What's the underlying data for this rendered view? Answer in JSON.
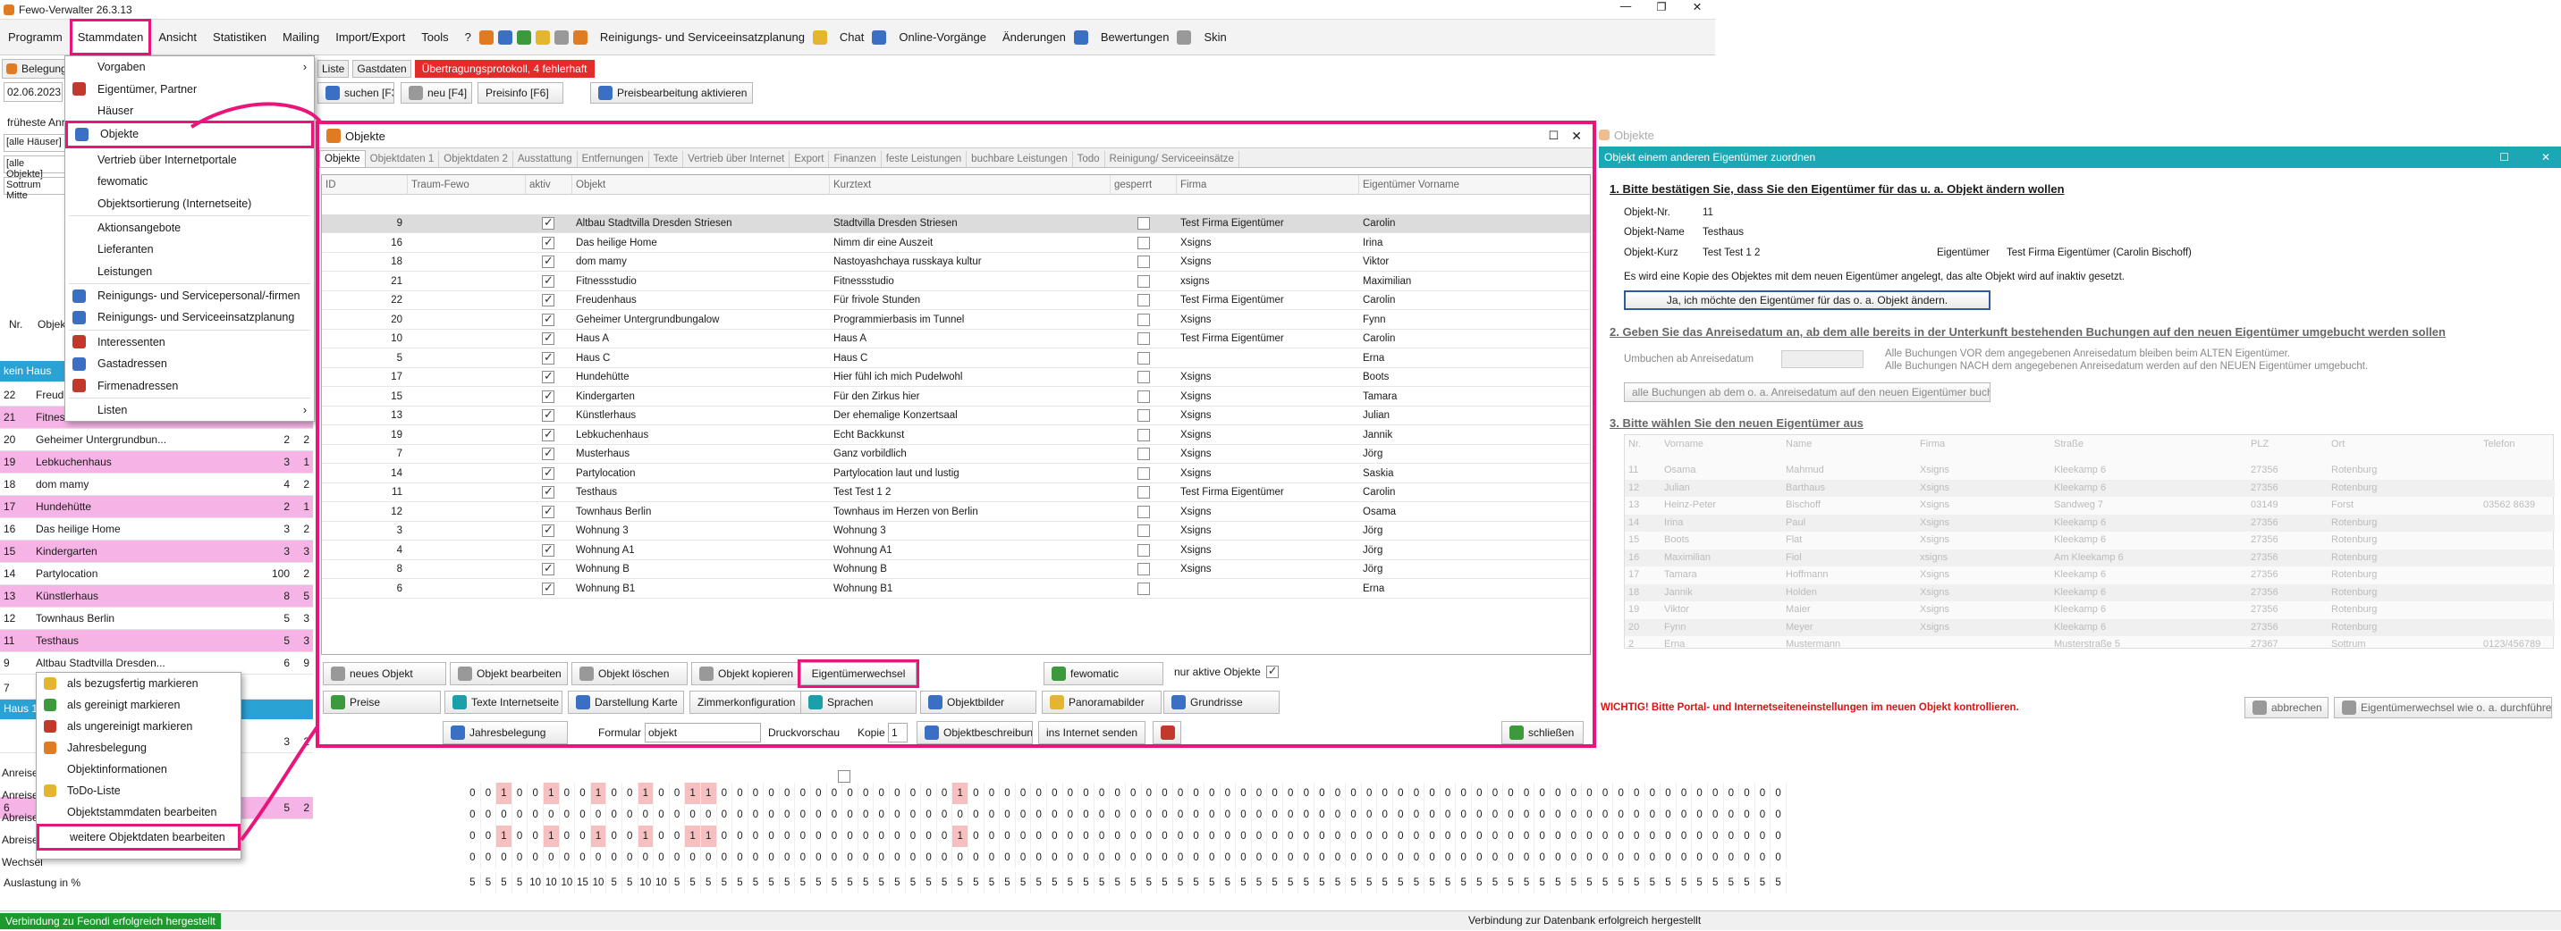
{
  "app": {
    "title": "Fewo-Verwalter 26.3.13"
  },
  "menubar": {
    "items": [
      "Programm",
      "Stammdaten",
      "Ansicht",
      "Statistiken",
      "Mailing",
      "Import/Export",
      "Tools",
      "?"
    ],
    "tb_plan": "Reinigungs- und Serviceeinsatzplanung",
    "tb_chat": "Chat",
    "tb_online": "Online-Vorgänge",
    "tb_changes": "Änderungen",
    "tb_ratings": "Bewertungen",
    "tb_skin": "Skin"
  },
  "toolbar2": {
    "liste": "Liste",
    "gastdaten": "Gastdaten",
    "error_badge": "Übertragungsprotokoll, 4 fehlerhaft",
    "suchen": "suchen [F3]",
    "neu": "neu [F4]",
    "preisinfo": "Preisinfo [F6]",
    "preisbearbeitung": "Preisbearbeitung aktivieren"
  },
  "stammdaten_menu": {
    "items": [
      "Vorgaben",
      "Eigentümer, Partner",
      "Häuser",
      "Objekte",
      "Vertrieb über Internetportale",
      "fewomatic",
      "Objektsortierung (Internetseite)",
      "Aktionsangebote",
      "Lieferanten",
      "Leistungen",
      "Reinigungs- und Servicepersonal/-firmen",
      "Reinigungs- und Serviceeinsatzplanung",
      "Interessenten",
      "Gastadressen",
      "Firmenadressen",
      "Listen"
    ]
  },
  "left": {
    "belegung": "Belegung",
    "date": "02.06.2023",
    "frueheste": "früheste Anrei",
    "filter1": "[alle Häuser]",
    "filter2": "[alle Objekte]",
    "filter3": "Sottrum Mitte",
    "col_nr": "Nr.",
    "col_obj": "Objek",
    "kein_haus": "kein Haus",
    "haus1": "Haus 1",
    "rows": [
      {
        "nr": "22",
        "name": "Freudenhaus",
        "a": "",
        "b": "",
        "pink": false
      },
      {
        "nr": "21",
        "name": "Fitnessstudio",
        "a": "",
        "b": "",
        "pink": true
      },
      {
        "nr": "20",
        "name": "Geheimer Untergrundbun...",
        "a": "2",
        "b": "2",
        "pink": false
      },
      {
        "nr": "19",
        "name": "Lebkuchenhaus",
        "a": "3",
        "b": "1",
        "pink": true
      },
      {
        "nr": "18",
        "name": "dom mamy",
        "a": "4",
        "b": "2",
        "pink": false
      },
      {
        "nr": "17",
        "name": "Hundehütte",
        "a": "2",
        "b": "1",
        "pink": true
      },
      {
        "nr": "16",
        "name": "Das heilige Home",
        "a": "3",
        "b": "2",
        "pink": false
      },
      {
        "nr": "15",
        "name": "Kindergarten",
        "a": "3",
        "b": "3",
        "pink": true
      },
      {
        "nr": "14",
        "name": "Partylocation",
        "a": "100",
        "b": "2",
        "pink": false
      },
      {
        "nr": "13",
        "name": "Künstlerhaus",
        "a": "8",
        "b": "5",
        "pink": true
      },
      {
        "nr": "12",
        "name": "Townhaus Berlin",
        "a": "5",
        "b": "3",
        "pink": false
      },
      {
        "nr": "11",
        "name": "Testhaus",
        "a": "5",
        "b": "3",
        "pink": true
      },
      {
        "nr": "9",
        "name": "Altbau Stadtvilla Dresden...",
        "a": "6",
        "b": "9",
        "pink": false
      }
    ],
    "row7": "7",
    "row6": "6",
    "row6b": "3",
    "row6c": "2",
    "row5a": "5",
    "row5b": "2"
  },
  "context_menu": {
    "items": [
      "als bezugsfertig markieren",
      "als gereinigt markieren",
      "als ungereinigt markieren",
      "Jahresbelegung",
      "Objektinformationen",
      "ToDo-Liste",
      "Objektstammdaten bearbeiten",
      "weitere Objektdaten bearbeiten"
    ]
  },
  "objwin": {
    "title": "Objekte",
    "tabs": [
      "Objekte",
      "Objektdaten 1",
      "Objektdaten 2",
      "Ausstattung",
      "Entfernungen",
      "Texte",
      "Vertrieb über Internet",
      "Export",
      "Finanzen",
      "feste Leistungen",
      "buchbare Leistungen",
      "Todo",
      "Reinigung/ Serviceeinsätze"
    ],
    "cols": [
      "ID",
      "Traum-Fewo",
      "aktiv",
      "Objekt",
      "Kurztext",
      "gesperrt",
      "Firma",
      "Eigentümer Vorname"
    ],
    "rows": [
      {
        "id": "9",
        "obj": "Altbau Stadtvilla Dresden Striesen",
        "kurz": "Stadtvilla Dresden Striesen",
        "firma": "Test Firma Eigentümer",
        "vn": "Carolin"
      },
      {
        "id": "16",
        "obj": "Das heilige Home",
        "kurz": "Nimm dir eine Auszeit",
        "firma": "Xsigns",
        "vn": "Irina"
      },
      {
        "id": "18",
        "obj": "dom mamy",
        "kurz": "Nastoyashchaya russkaya kultur",
        "firma": "Xsigns",
        "vn": "Viktor"
      },
      {
        "id": "21",
        "obj": "Fitnessstudio",
        "kurz": "Fitnessstudio",
        "firma": "xsigns",
        "vn": "Maximilian"
      },
      {
        "id": "22",
        "obj": "Freudenhaus",
        "kurz": "Für frivole Stunden",
        "firma": "Test Firma Eigentümer",
        "vn": "Carolin"
      },
      {
        "id": "20",
        "obj": "Geheimer Untergrundbungalow",
        "kurz": "Programmierbasis im Tunnel",
        "firma": "Xsigns",
        "vn": "Fynn"
      },
      {
        "id": "10",
        "obj": "Haus A",
        "kurz": "Haus A",
        "firma": "Test Firma Eigentümer",
        "vn": "Carolin"
      },
      {
        "id": "5",
        "obj": "Haus C",
        "kurz": "Haus C",
        "firma": "",
        "vn": "Erna"
      },
      {
        "id": "17",
        "obj": "Hundehütte",
        "kurz": "Hier fühl ich mich Pudelwohl",
        "firma": "Xsigns",
        "vn": "Boots"
      },
      {
        "id": "15",
        "obj": "Kindergarten",
        "kurz": "Für den Zirkus hier",
        "firma": "Xsigns",
        "vn": "Tamara"
      },
      {
        "id": "13",
        "obj": "Künstlerhaus",
        "kurz": "Der ehemalige Konzertsaal",
        "firma": "Xsigns",
        "vn": "Julian"
      },
      {
        "id": "19",
        "obj": "Lebkuchenhaus",
        "kurz": "Echt Backkunst",
        "firma": "Xsigns",
        "vn": "Jannik"
      },
      {
        "id": "7",
        "obj": "Musterhaus",
        "kurz": "Ganz vorbildlich",
        "firma": "Xsigns",
        "vn": "Jörg"
      },
      {
        "id": "14",
        "obj": "Partylocation",
        "kurz": "Partylocation laut und lustig",
        "firma": "Xsigns",
        "vn": "Saskia"
      },
      {
        "id": "11",
        "obj": "Testhaus",
        "kurz": "Test Test 1 2",
        "firma": "Test Firma Eigentümer",
        "vn": "Carolin"
      },
      {
        "id": "12",
        "obj": "Townhaus Berlin",
        "kurz": "Townhaus im Herzen von Berlin",
        "firma": "Xsigns",
        "vn": "Osama"
      },
      {
        "id": "3",
        "obj": "Wohnung 3",
        "kurz": "Wohnung 3",
        "firma": "Xsigns",
        "vn": "Jörg"
      },
      {
        "id": "4",
        "obj": "Wohnung A1",
        "kurz": "Wohnung A1",
        "firma": "Xsigns",
        "vn": "Jörg"
      },
      {
        "id": "8",
        "obj": "Wohnung B",
        "kurz": "Wohnung B",
        "firma": "Xsigns",
        "vn": "Jörg"
      },
      {
        "id": "6",
        "obj": "Wohnung B1",
        "kurz": "Wohnung B1",
        "firma": "",
        "vn": "Erna"
      }
    ],
    "btn": {
      "neu": "neues Objekt",
      "bearb": "Objekt bearbeiten",
      "loesch": "Objekt löschen",
      "kopie": "Objekt kopieren",
      "eigwechsel": "Eigentümerwechsel",
      "fewomatic": "fewomatic",
      "nuraktiv": "nur aktive Objekte",
      "preise": "Preise",
      "texte": "Texte Internetseite",
      "karte": "Darstellung Karte",
      "zimmer": "Zimmerkonfiguration",
      "sprachen": "Sprachen",
      "bilder": "Objektbilder",
      "panorama": "Panoramabilder",
      "grundriss": "Grundrisse",
      "jahres": "Jahresbelegung",
      "formular": "Formular",
      "formval": "objekt",
      "druckvorschau": "Druckvorschau",
      "kopie_lbl": "Kopie",
      "kopie_val": "1",
      "beschr": "Objektbeschreibung",
      "internet": "ins Internet senden",
      "schliessen": "schließen"
    }
  },
  "rightwin": {
    "bg_title": "Objekte",
    "title": "Objekt einem anderen Eigentümer zuordnen",
    "h1": "1. Bitte bestätigen Sie, dass Sie den Eigentümer für das u. a. Objekt ändern wollen",
    "objnr_l": "Objekt-Nr.",
    "objnr": "11",
    "objname_l": "Objekt-Name",
    "objname": "Testhaus",
    "objkurz_l": "Objekt-Kurz",
    "objkurz": "Test Test 1 2",
    "eig_l": "Eigentümer",
    "eig": "Test Firma Eigentümer (Carolin Bischoff)",
    "info": "Es wird eine Kopie des Objektes mit dem neuen Eigentümer angelegt, das alte Objekt wird auf inaktiv gesetzt.",
    "confirm": "Ja, ich möchte den Eigentümer für das o. a. Objekt ändern.",
    "h2": "2. Geben Sie das Anreisedatum an, ab dem alle bereits in der Unterkunft bestehenden Buchungen auf den neuen Eigentümer umgebucht werden sollen",
    "umbuchen": "Umbuchen ab Anreisedatum",
    "note1": "Alle Buchungen VOR dem angegebenen Anreisedatum  bleiben beim ALTEN Eigentümer.",
    "note2": "Alle Buchungen NACH dem angegebenen Anreisedatum werden auf den NEUEN Eigentümer umgebucht.",
    "allbtn": "alle Buchungen ab dem o. a. Anreisedatum auf den neuen Eigentümer buchen",
    "h3": "3. Bitte wählen Sie den neuen Eigentümer aus",
    "cols": [
      "Nr.",
      "Vorname",
      "Name",
      "Firma",
      "Straße",
      "PLZ",
      "Ort",
      "Telefon"
    ],
    "rows": [
      [
        "11",
        "Osama",
        "Mahmud",
        "Xsigns",
        "Kleekamp 6",
        "27356",
        "Rotenburg",
        ""
      ],
      [
        "12",
        "Julian",
        "Barthaus",
        "Xsigns",
        "Kleekamp 6",
        "27356",
        "Rotenburg",
        ""
      ],
      [
        "13",
        "Heinz-Peter",
        "Bischoff",
        "Xsigns",
        "Sandweg 7",
        "03149",
        "Forst",
        "03562 8639"
      ],
      [
        "14",
        "Irina",
        "Paul",
        "Xsigns",
        "Kleekamp 6",
        "27356",
        "Rotenburg",
        ""
      ],
      [
        "15",
        "Boots",
        "Flat",
        "Xsigns",
        "Kleekamp 6",
        "27356",
        "Rotenburg",
        ""
      ],
      [
        "16",
        "Maximilian",
        "Fiol",
        "xsigns",
        "Am Kleekamp 6",
        "27356",
        "Rotenburg",
        ""
      ],
      [
        "17",
        "Tamara",
        "Hoffmann",
        "Xsigns",
        "Kleekamp 6",
        "27356",
        "Rotenburg",
        ""
      ],
      [
        "18",
        "Jannik",
        "Holden",
        "Xsigns",
        "Kleekamp 6",
        "27356",
        "Rotenburg",
        ""
      ],
      [
        "19",
        "Viktor",
        "Maier",
        "Xsigns",
        "Kleekamp 6",
        "27356",
        "Rotenburg",
        ""
      ],
      [
        "20",
        "Fynn",
        "Meyer",
        "Xsigns",
        "Kleekamp 6",
        "27356",
        "Rotenburg",
        ""
      ],
      [
        "2",
        "Erna",
        "Mustermann",
        "",
        "Musterstraße 5",
        "27367",
        "Sottrum",
        "0123/456789"
      ]
    ],
    "warning": "WICHTIG! Bitte Portal- und Internetseiteneinstellungen im neuen Objekt kontrollieren.",
    "abbrechen": "abbrechen",
    "durchfuehren": "Eigentümerwechsel wie o. a. durchführen"
  },
  "bottom": {
    "labels": [
      "Anreise",
      "Anreise",
      "Abreise",
      "Abreise",
      "Wechsel"
    ],
    "auslastung": "Auslastung in %",
    "r1": "0 0 1 0 0 1 0 0 1 0 0 1 0 0 1 1 0 0 0 0 0 0 0 0 0 0 0 0 0 0 0 1 0 0 0 0 0 0 0 0 0 0 0 0 0 0 0 0 0 0 0 0 0 0 0 0 0 0 0 0 0 0 0 0 0 0 0 0 0 0 0 0 0 0 0 0 0 0 0 0 0 0 0 0",
    "r2": "0 0 0 0 0 0 0 0 0 0 0 0 0 0 0 0 0 0 0 0 0 0 0 0 0 0 0 0 0 0 0 0 0 0 0 0 0 0 0 0 0 0 0 0 0 0 0 0 0 0 0 0 0 0 0 0 0 0 0 0 0 0 0 0 0 0 0 0 0 0 0 0 0 0 0 0 0 0 0 0 0 0 0 0",
    "aus": "5 5 5 5 10 10 10 15 10 5 5 10 10 5 5 5 5 5 5 5 5 5 5 5 5 5 5 5 5 5 5 5 5 5 5 5 5 5 5 5 5 5 5 5 5 5 5 5 5 5 5 5 5 5 5 5 5 5 5 5 5 5 5 5 5 5 5 5 5 5 5 5 5 5 5 5 5 5 5 5 5 5 5 5"
  },
  "status": {
    "left": "Verbindung zu Feondi erfolgreich hergestellt",
    "right": "Verbindung zur Datenbank erfolgreich hergestellt"
  }
}
